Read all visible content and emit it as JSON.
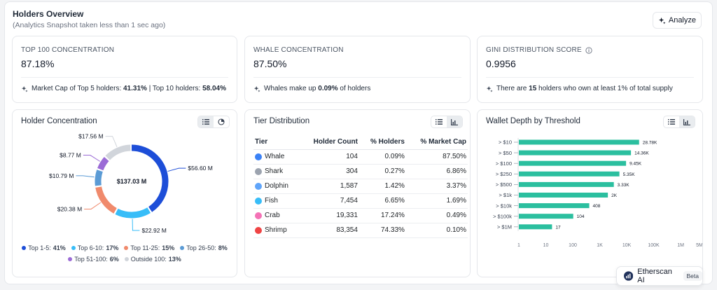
{
  "header": {
    "title": "Holders Overview",
    "subtitle": "(Analytics Snapshot taken less than 1 sec ago)",
    "analyze_label": "Analyze"
  },
  "stats": [
    {
      "label": "TOP 100 CONCENTRATION",
      "value": "87.18%",
      "foot_prefix": "Market Cap of Top 5 holders: ",
      "foot_bold1": "41.31%",
      "foot_mid": " | Top 10 holders: ",
      "foot_bold2": "58.04%"
    },
    {
      "label": "WHALE CONCENTRATION",
      "value": "87.50%",
      "foot_prefix": "Whales make up ",
      "foot_bold1": "0.09%",
      "foot_mid": " of holders"
    },
    {
      "label": "GINI DISTRIBUTION SCORE",
      "value": "0.9956",
      "foot_prefix": "There are ",
      "foot_bold1": "15",
      "foot_mid": " holders who own at least 1% of total supply"
    }
  ],
  "holder_concentration": {
    "title": "Holder Concentration",
    "center_label": "$137.03 M",
    "legend": [
      {
        "name": "Top 1-5:",
        "pct": "41%"
      },
      {
        "name": "Top 6-10:",
        "pct": "17%"
      },
      {
        "name": "Top 11-25:",
        "pct": "15%"
      },
      {
        "name": "Top 26-50:",
        "pct": "8%"
      },
      {
        "name": "Top 51-100:",
        "pct": "6%"
      },
      {
        "name": "Outside 100:",
        "pct": "13%"
      }
    ]
  },
  "tier_distribution": {
    "title": "Tier Distribution",
    "columns": [
      "Tier",
      "Holder Count",
      "% Holders",
      "% Market Cap"
    ],
    "rows": [
      {
        "tier": "Whale",
        "count": "104",
        "pct_holders": "0.09%",
        "pct_cap": "87.50%",
        "color": "#3b82f6"
      },
      {
        "tier": "Shark",
        "count": "304",
        "pct_holders": "0.27%",
        "pct_cap": "6.86%",
        "color": "#9ca3af"
      },
      {
        "tier": "Dolphin",
        "count": "1,587",
        "pct_holders": "1.42%",
        "pct_cap": "3.37%",
        "color": "#60a5fa"
      },
      {
        "tier": "Fish",
        "count": "7,454",
        "pct_holders": "6.65%",
        "pct_cap": "1.69%",
        "color": "#38bdf8"
      },
      {
        "tier": "Crab",
        "count": "19,331",
        "pct_holders": "17.24%",
        "pct_cap": "0.49%",
        "color": "#f472b6"
      },
      {
        "tier": "Shrimp",
        "count": "83,354",
        "pct_holders": "74.33%",
        "pct_cap": "0.10%",
        "color": "#ef4444"
      }
    ]
  },
  "wallet_depth": {
    "title": "Wallet Depth by Threshold"
  },
  "assistant": {
    "label": "Etherscan AI",
    "badge": "Beta"
  },
  "chart_data": [
    {
      "type": "pie",
      "categories": [
        "Top 1-5",
        "Top 6-10",
        "Top 11-25",
        "Top 26-50",
        "Top 51-100",
        "Outside 100"
      ],
      "values": [
        56.6,
        22.92,
        20.38,
        10.79,
        8.77,
        17.56
      ],
      "labels": [
        "$56.60 M",
        "$22.92 M",
        "$20.38 M",
        "$10.79 M",
        "$8.77 M",
        "$17.56 M"
      ],
      "colors": [
        "#1d4ed8",
        "#38bdf8",
        "#f08a6c",
        "#5b9bd5",
        "#9b6bd6",
        "#d1d5db"
      ],
      "total_label": "$137.03 M",
      "donut": true
    },
    {
      "type": "bar",
      "orientation": "horizontal",
      "categories": [
        "> $10",
        "> $50",
        "> $100",
        "> $250",
        "> $500",
        "> $1k",
        "> $10k",
        "> $100k",
        "> $1M"
      ],
      "values": [
        28780,
        14360,
        9450,
        5350,
        3330,
        2000,
        408,
        104,
        17
      ],
      "labels": [
        "28.78K",
        "14.36K",
        "9.45K",
        "5.35K",
        "3.33K",
        "2K",
        "408",
        "104",
        "17"
      ],
      "x_scale": "log",
      "x_ticks": [
        1,
        10,
        100,
        1000,
        10000,
        100000,
        1000000,
        5000000
      ],
      "x_tick_labels": [
        "1",
        "10",
        "100",
        "1K",
        "10K",
        "100K",
        "1M",
        "5M"
      ],
      "color": "#2bbf9f"
    }
  ]
}
